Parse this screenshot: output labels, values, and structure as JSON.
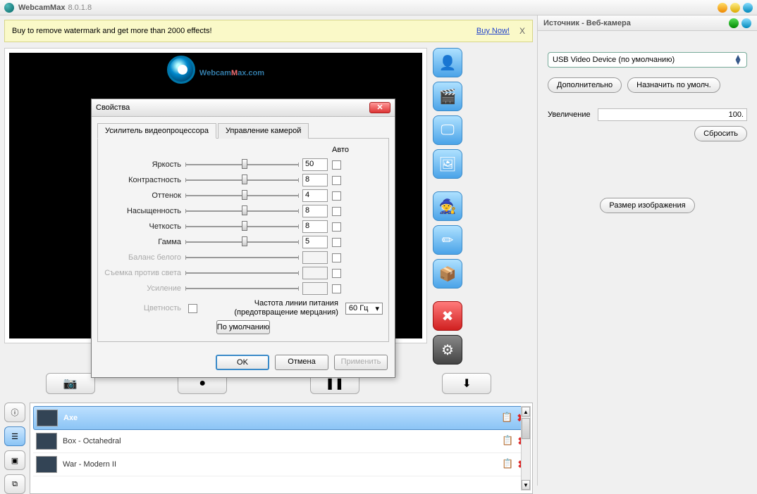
{
  "app": {
    "name": "WebcamMax",
    "version": "8.0.1.8"
  },
  "promo": {
    "text": "Buy to remove watermark and get more than 2000 effects!",
    "buy": "Buy Now!"
  },
  "brand": {
    "part1": "Webcam",
    "m": "M",
    "part2": "ax.com"
  },
  "sideIcons": [
    "person",
    "video",
    "screen",
    "picture",
    "wizard",
    "draw",
    "package",
    "cancel",
    "gear"
  ],
  "controls": {
    "snapshot": "📷",
    "record": "●",
    "pause": "❚❚",
    "download": "▼"
  },
  "effects": [
    {
      "name": "Axe",
      "selected": true
    },
    {
      "name": "Box - Octahedral",
      "selected": false
    },
    {
      "name": "War - Modern II",
      "selected": false
    }
  ],
  "rightPanel": {
    "title": "Источник - Веб-камера",
    "device": "USB Video Device (по умолчанию)",
    "advanced": "Дополнительно",
    "setDefault": "Назначить по умолч.",
    "zoomLabel": "Увеличение",
    "zoomValue": "100.",
    "reset": "Сбросить",
    "imageSize": "Размер изображения"
  },
  "dialog": {
    "title": "Свойства",
    "tab1": "Усилитель видеопроцессора",
    "tab2": "Управление камерой",
    "autoHeader": "Авто",
    "props": [
      {
        "label": "Яркость",
        "value": "50",
        "pos": 50,
        "enabled": true
      },
      {
        "label": "Контрастность",
        "value": "8",
        "pos": 50,
        "enabled": true
      },
      {
        "label": "Оттенок",
        "value": "4",
        "pos": 50,
        "enabled": true
      },
      {
        "label": "Насыщенность",
        "value": "8",
        "pos": 50,
        "enabled": true
      },
      {
        "label": "Четкость",
        "value": "8",
        "pos": 50,
        "enabled": true
      },
      {
        "label": "Гамма",
        "value": "5",
        "pos": 50,
        "enabled": true
      },
      {
        "label": "Баланс белого",
        "value": "",
        "pos": 0,
        "enabled": false
      },
      {
        "label": "Съемка против света",
        "value": "",
        "pos": 0,
        "enabled": false
      },
      {
        "label": "Усиление",
        "value": "",
        "pos": 0,
        "enabled": false
      }
    ],
    "colorLabel": "Цветность",
    "freqLabel1": "Частота линии питания",
    "freqLabel2": "(предотвращение мерцания)",
    "freqValue": "60 Гц",
    "defaultBtn": "По умолчанию",
    "ok": "OK",
    "cancel": "Отмена",
    "apply": "Применить"
  }
}
